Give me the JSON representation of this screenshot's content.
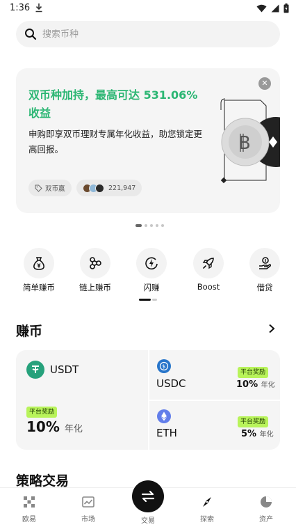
{
  "status_bar": {
    "time": "1:36",
    "download_icon": "download-icon",
    "wifi_icon": "wifi-icon",
    "signal_icon": "signal-icon",
    "battery_icon": "battery-charging-icon"
  },
  "search": {
    "placeholder": "搜索币种",
    "icon": "search-icon"
  },
  "banner": {
    "title": "双币种加持，最高可达 531.06% 收益",
    "description": "申购即享双币理财专属年化收益，助您锁定更高回报。",
    "tag_label": "双币赢",
    "participants": "221,947",
    "accent_color": "#2bb673",
    "close_icon": "close-icon",
    "pages": 5,
    "active_page": 1
  },
  "quick_actions": [
    {
      "label": "简单赚币",
      "icon": "money-bag-icon"
    },
    {
      "label": "链上赚币",
      "icon": "onchain-nodes-icon"
    },
    {
      "label": "闪赚",
      "icon": "flash-icon"
    },
    {
      "label": "Boost",
      "icon": "rocket-icon"
    },
    {
      "label": "借贷",
      "icon": "loan-hand-icon"
    }
  ],
  "earn": {
    "title": "赚币",
    "more_icon": "chevron-right-icon",
    "usdt": {
      "name": "USDT",
      "badge": "平台奖励",
      "rate": "10%",
      "unit": "年化",
      "color": "#26a17b"
    },
    "usdc": {
      "name": "USDC",
      "badge": "平台奖励",
      "rate": "10%",
      "unit": "年化",
      "color": "#2775ca"
    },
    "eth": {
      "name": "ETH",
      "badge": "平台奖励",
      "rate": "5%",
      "unit": "年化",
      "color": "#627eea"
    },
    "badge_color": "#b8f35a"
  },
  "strategy": {
    "title": "策略交易"
  },
  "tabbar": {
    "items": [
      {
        "label": "欧易",
        "icon": "okx-logo-icon"
      },
      {
        "label": "市场",
        "icon": "chart-icon"
      },
      {
        "label": "交易",
        "icon": "swap-arrows-icon"
      },
      {
        "label": "探索",
        "icon": "compass-icon"
      },
      {
        "label": "资产",
        "icon": "pie-icon"
      }
    ],
    "active": "探索"
  }
}
